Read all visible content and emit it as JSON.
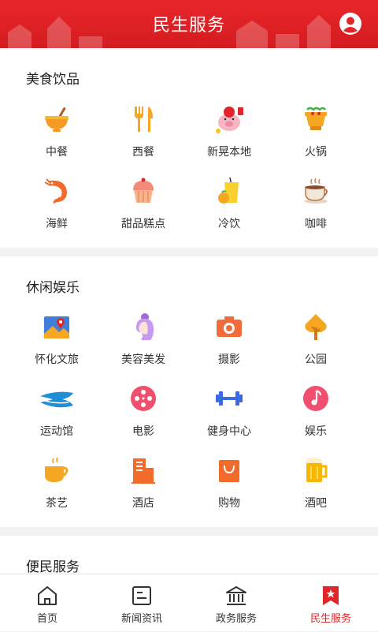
{
  "header": {
    "title": "民生服务",
    "avatar_icon": "user-avatar-icon"
  },
  "sections": [
    {
      "title": "美食饮品",
      "items": [
        {
          "label": "中餐",
          "icon": "noodle-bowl-icon"
        },
        {
          "label": "西餐",
          "icon": "fork-knife-icon"
        },
        {
          "label": "新晃本地",
          "icon": "lucky-pig-icon"
        },
        {
          "label": "火锅",
          "icon": "hotpot-icon"
        },
        {
          "label": "海鲜",
          "icon": "shrimp-icon"
        },
        {
          "label": "甜品糕点",
          "icon": "cupcake-icon"
        },
        {
          "label": "冷饮",
          "icon": "cold-drink-icon"
        },
        {
          "label": "咖啡",
          "icon": "coffee-icon"
        }
      ]
    },
    {
      "title": "休闲娱乐",
      "items": [
        {
          "label": "怀化文旅",
          "icon": "map-pin-icon"
        },
        {
          "label": "美容美发",
          "icon": "beauty-hair-icon"
        },
        {
          "label": "摄影",
          "icon": "camera-icon"
        },
        {
          "label": "公园",
          "icon": "tree-icon"
        },
        {
          "label": "运动馆",
          "icon": "stadium-icon"
        },
        {
          "label": "电影",
          "icon": "film-reel-icon"
        },
        {
          "label": "健身中心",
          "icon": "dumbbell-icon"
        },
        {
          "label": "娱乐",
          "icon": "music-note-icon"
        },
        {
          "label": "茶艺",
          "icon": "tea-cup-icon"
        },
        {
          "label": "酒店",
          "icon": "hotel-building-icon"
        },
        {
          "label": "购物",
          "icon": "shopping-bag-icon"
        },
        {
          "label": "酒吧",
          "icon": "beer-mug-icon"
        }
      ]
    },
    {
      "title": "便民服务",
      "items": []
    }
  ],
  "tabbar": [
    {
      "label": "首页",
      "icon": "home-icon",
      "active": false
    },
    {
      "label": "新闻资讯",
      "icon": "news-icon",
      "active": false
    },
    {
      "label": "政务服务",
      "icon": "government-building-icon",
      "active": false
    },
    {
      "label": "民生服务",
      "icon": "bookmark-star-icon",
      "active": true
    }
  ],
  "colors": {
    "brand_red": "#e0262b",
    "icon_orange": "#f5a623"
  }
}
